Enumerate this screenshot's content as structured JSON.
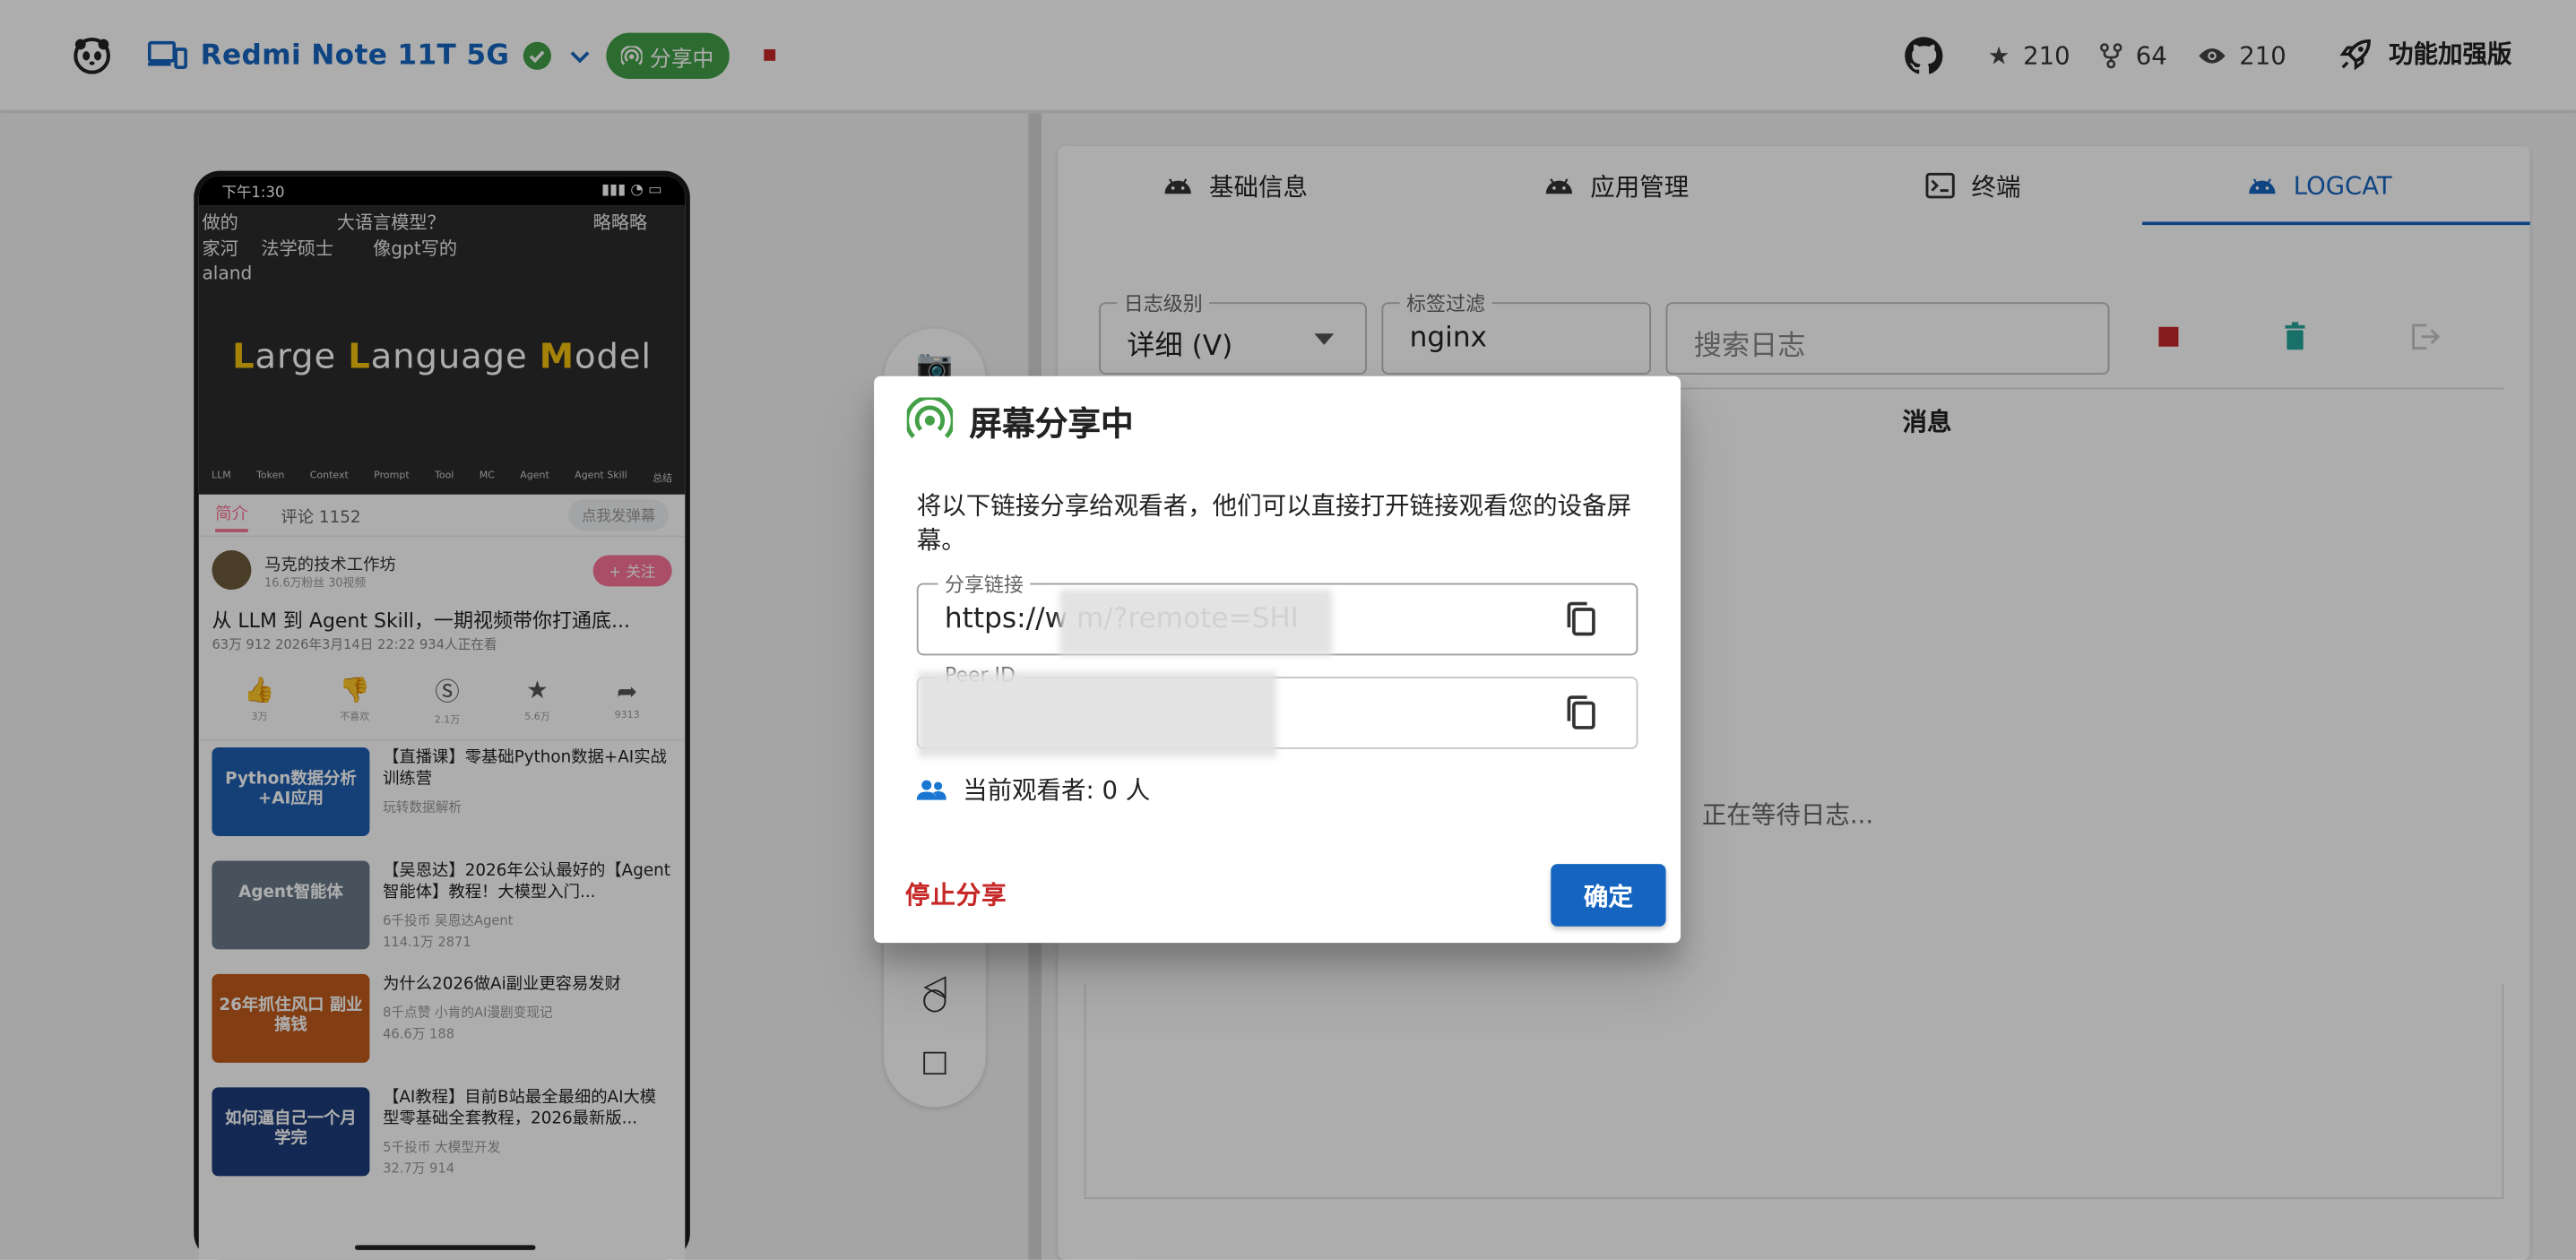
{
  "topbar": {
    "device_name": "Redmi Note 11T 5G",
    "share_chip": "分享中",
    "stars": "210",
    "forks": "64",
    "watchers": "210",
    "boost_label": "功能加强版"
  },
  "phone": {
    "status_time": "下午1:30",
    "video_line1": "做的",
    "video_line1b": "大语言模型？",
    "video_line1c": "略略略",
    "video_line2": "家河",
    "video_line2b": "法学硕士",
    "video_line2c": "像gpt写的",
    "video_line3": "aland",
    "video_heading": "Large Language Model",
    "video_chapters": [
      "LLM",
      "Token",
      "Context",
      "Prompt",
      "Tool",
      "MC",
      "Agent",
      "Agent Skill",
      "总结"
    ],
    "tab_intro": "简介",
    "tab_comments": "评论 1152",
    "danmu_placeholder": "点我发弹幕",
    "uploader_name": "马克的技术工作坊",
    "uploader_meta": "16.6万粉丝  30视频",
    "follow_label": "+ 关注",
    "video_title": "从 LLM 到 Agent Skill，一期视频带你打通底...",
    "video_meta": "63万  912  2026年3月14日 22:22  934人正在看",
    "actions": [
      {
        "icon": "like-icon",
        "glyph": "👍",
        "label": "3万"
      },
      {
        "icon": "dislike-icon",
        "glyph": "👎",
        "label": "不喜欢"
      },
      {
        "icon": "coin-icon",
        "glyph": "Ⓢ",
        "label": "2.1万"
      },
      {
        "icon": "favorite-icon",
        "glyph": "★",
        "label": "5.6万"
      },
      {
        "icon": "share-icon",
        "glyph": "➦",
        "label": "9313"
      }
    ],
    "recommendations": [
      {
        "title": "【直播课】零基础Python数据+AI实战训练营",
        "meta": "玩转数据解析",
        "thumb_color": "#1e5fb0",
        "thumb_text": "Python数据分析 +AI应用"
      },
      {
        "title": "【吴恩达】2026年公认最好的【Agent智能体】教程！大模型入门...",
        "meta": "6千投币 吴恩达Agent",
        "meta2": "114.1万  2871",
        "thumb_color": "#6b7a8a",
        "thumb_text": "Agent智能体"
      },
      {
        "title": "为什么2026做Ai副业更容易发财",
        "meta": "8千点赞 小肯的AI漫剧变现记",
        "meta2": "46.6万  188",
        "thumb_color": "#c05a1c",
        "thumb_text": "26年抓住风口 副业搞钱"
      },
      {
        "title": "【AI教程】目前B站最全最细的AI大模型零基础全套教程，2026最新版...",
        "meta": "5千投币 大模型开发",
        "meta2": "32.7万  914",
        "thumb_color": "#1d3b7a",
        "thumb_text": "如何逼自己一个月学完"
      }
    ]
  },
  "tabs": [
    {
      "label": "基础信息",
      "icon": "android-icon"
    },
    {
      "label": "应用管理",
      "icon": "android-icon"
    },
    {
      "label": "终端",
      "icon": "terminal-icon"
    },
    {
      "label": "LOGCAT",
      "icon": "android-icon"
    }
  ],
  "logcat": {
    "level_label": "日志级别",
    "level_value": "详细 (V)",
    "tag_label": "标签过滤",
    "tag_value": "nginx",
    "search_placeholder": "搜索日志",
    "col_message": "消息",
    "waiting": "正在等待日志..."
  },
  "dialog": {
    "title": "屏幕分享中",
    "description": "将以下链接分享给观看者，他们可以直接打开链接观看您的设备屏幕。",
    "link_label": "分享链接",
    "link_value": "https://w                          m/?remote=SHI",
    "peer_label": "Peer ID",
    "peer_value": "",
    "viewers": "当前观看者: 0 人",
    "stop_label": "停止分享",
    "ok_label": "确定"
  },
  "colors": {
    "primary": "#1565c0",
    "share_green": "#43a047",
    "danger": "#c62828",
    "teal": "#26a69a"
  }
}
